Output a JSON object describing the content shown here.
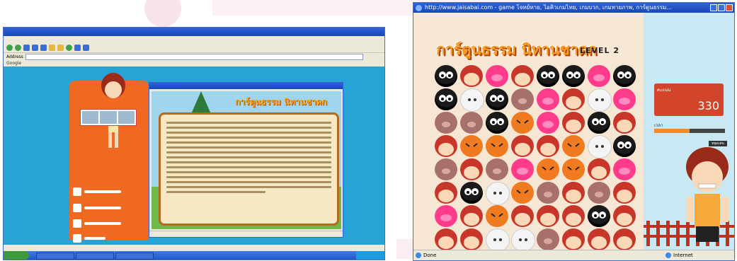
{
  "left_window": {
    "title": "",
    "menu": "",
    "address_label": "Address",
    "google_label": "Google",
    "popup_title": "",
    "game_logo": "การ์ตูนธรรม นิทานชาดก"
  },
  "right_window": {
    "title": "http://www.jaisabai.com - game โจทย์ทาย, ไอคิวเกมไทย, เกมบวก, เกมทายภาพ, การ์ตูนธรรม...",
    "game_title": "การ์ตูนธรรม นิทานชาดก",
    "level_label": "LEVEL",
    "level_value": "2",
    "score_label": "คะแนน",
    "score_value": "330",
    "time_label": "เวลา",
    "time_fraction": 0.5,
    "pause_label": "หยุดเล่น",
    "status_left": "Done",
    "status_right": "Internet"
  },
  "colors": {
    "orange": "#ef6a20",
    "site_blue": "#27a3d6",
    "xp_title": "#2f62d6",
    "score_red": "#d2452a",
    "tile_black": "#1a1a1a",
    "tile_red": "#c8362a",
    "tile_pink": "#ff3c8c",
    "tile_brown": "#a8706a",
    "tile_orange": "#f07a20",
    "tile_white": "#f4f4f4"
  },
  "board": [
    [
      "black",
      "red",
      "pink",
      "red",
      "black",
      "black",
      "pink",
      "black"
    ],
    [
      "black",
      "white",
      "black",
      "brown",
      "pink",
      "red",
      "white",
      "pink"
    ],
    [
      "brown",
      "brown",
      "black",
      "orange",
      "pink",
      "red",
      "black",
      "red"
    ],
    [
      "red",
      "orange",
      "orange",
      "red",
      "red",
      "orange",
      "white",
      "black"
    ],
    [
      "brown",
      "red",
      "brown",
      "pink",
      "orange",
      "orange",
      "red",
      "pink"
    ],
    [
      "red",
      "black",
      "white",
      "orange",
      "brown",
      "red",
      "brown",
      "red"
    ],
    [
      "pink",
      "red",
      "orange",
      "red",
      "red",
      "red",
      "black",
      "red"
    ],
    [
      "red",
      "red",
      "white",
      "white",
      "brown",
      "red",
      "red",
      "red"
    ]
  ]
}
